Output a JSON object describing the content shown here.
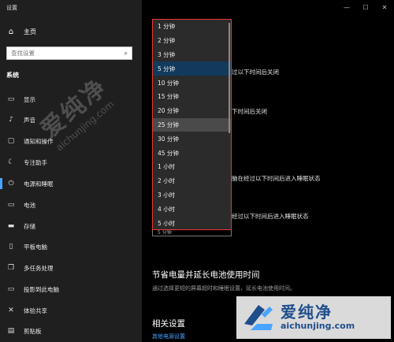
{
  "window": {
    "title": "设置",
    "controls": [
      "—",
      "☐",
      "✕"
    ]
  },
  "sidebar": {
    "home": {
      "label": "主页",
      "icon": "home-icon"
    },
    "search": {
      "placeholder": "查找设置",
      "icon": "search-icon"
    },
    "section_title": "系统",
    "items": [
      {
        "label": "显示",
        "icon": "display-icon",
        "active": false
      },
      {
        "label": "声音",
        "icon": "sound-icon",
        "active": false
      },
      {
        "label": "通知和操作",
        "icon": "notification-icon",
        "active": false
      },
      {
        "label": "专注助手",
        "icon": "moon-icon",
        "active": false
      },
      {
        "label": "电源和睡眠",
        "icon": "power-icon",
        "active": true
      },
      {
        "label": "电池",
        "icon": "battery-icon",
        "active": false
      },
      {
        "label": "存储",
        "icon": "storage-icon",
        "active": false
      },
      {
        "label": "平板电脑",
        "icon": "tablet-icon",
        "active": false
      },
      {
        "label": "多任务处理",
        "icon": "multitask-icon",
        "active": false
      },
      {
        "label": "投影到此电脑",
        "icon": "project-icon",
        "active": false
      },
      {
        "label": "体验共享",
        "icon": "share-icon",
        "active": false
      },
      {
        "label": "剪贴板",
        "icon": "clipboard-icon",
        "active": false
      }
    ]
  },
  "watermark_left": {
    "cn": "爱纯净",
    "en": "aichunjing.com"
  },
  "dropdown": {
    "options": [
      "1 分钟",
      "2 分钟",
      "3 分钟",
      "5 分钟",
      "10 分钟",
      "15 分钟",
      "20 分钟",
      "25 分钟",
      "30 分钟",
      "45 分钟",
      "1 小时",
      "2 小时",
      "3 小时",
      "4 小时",
      "5 小时"
    ],
    "selected_index": 3,
    "hover_index": 7,
    "combo_partial_text": "5 分钟"
  },
  "main": {
    "partial_labels": [
      "过以下时间后关闭",
      "下时间后关闭",
      "脑在经过以下时间后进入睡眠状态",
      "经过以下时间后进入睡眠状态"
    ],
    "save_power_title": "节省电量并延长电池使用时间",
    "save_power_desc": "通过选择更短的屏幕超时和睡眠设置，延长电池使用时间。",
    "related_title": "相关设置",
    "related_link": "其他电源设置"
  },
  "watermark_right": {
    "cn": "爱纯净",
    "en": "aichunjing.com"
  },
  "colors": {
    "accent": "#4aa3ff",
    "highlight_border": "#e53935",
    "selected_option": "#123a5c",
    "sidebar_bg": "#1f1f1f"
  }
}
